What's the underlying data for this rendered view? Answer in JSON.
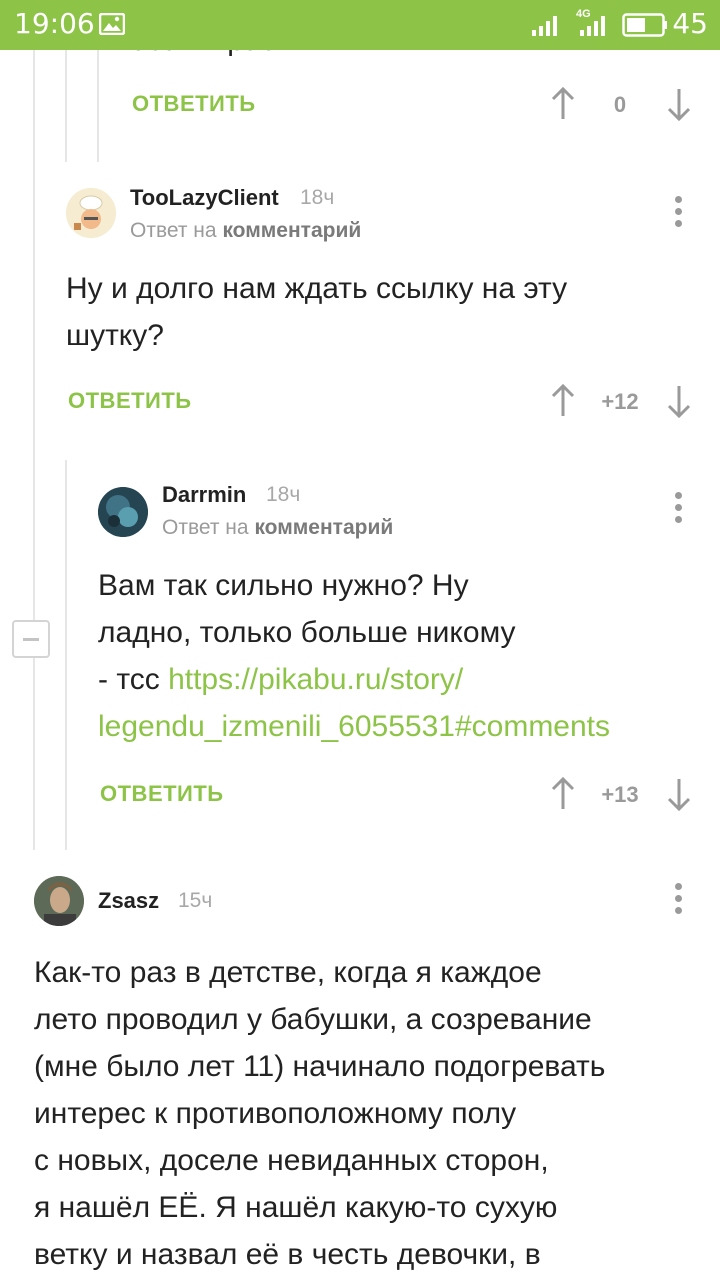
{
  "status_bar": {
    "time": "19:06",
    "network": "4G",
    "battery": "45"
  },
  "clipped_comment": {
    "text_fragment": "ебать \"распять?",
    "reply": "ОТВЕТИТЬ",
    "score": "0"
  },
  "comments": [
    {
      "username": "TooLazyClient",
      "time": "18ч",
      "reply_prefix": "Ответ на",
      "reply_target": "комментарий",
      "text_lines": [
        "Ну и долго нам ждать ссылку на эту",
        "шутку?"
      ],
      "reply": "ОТВЕТИТЬ",
      "score": "+12"
    },
    {
      "username": "Darrmin",
      "time": "18ч",
      "reply_prefix": "Ответ на",
      "reply_target": "комментарий",
      "text_lines": [
        "Вам так сильно нужно? Ну",
        "ладно, только больше никому",
        "- тсс "
      ],
      "link_part1": "https://pikabu.ru/story/",
      "link_part2": "legendu_izmenili_6055531#comments",
      "reply": "ОТВЕТИТЬ",
      "score": "+13"
    },
    {
      "username": "Zsasz",
      "time": "15ч",
      "text_lines": [
        "Как-то раз в детстве, когда я каждое",
        "лето проводил у бабушки, а созревание",
        "(мне было лет 11) начинало подогревать",
        "интерес к противоположному полу",
        "с новых, доселе невиданных сторон,",
        "я нашёл ЕЁ. Я нашёл какую-то сухую",
        "ветку и назвал её в честь девочки, в"
      ]
    }
  ],
  "colors": {
    "accent": "#8dc448",
    "muted": "#9a9a9a"
  }
}
